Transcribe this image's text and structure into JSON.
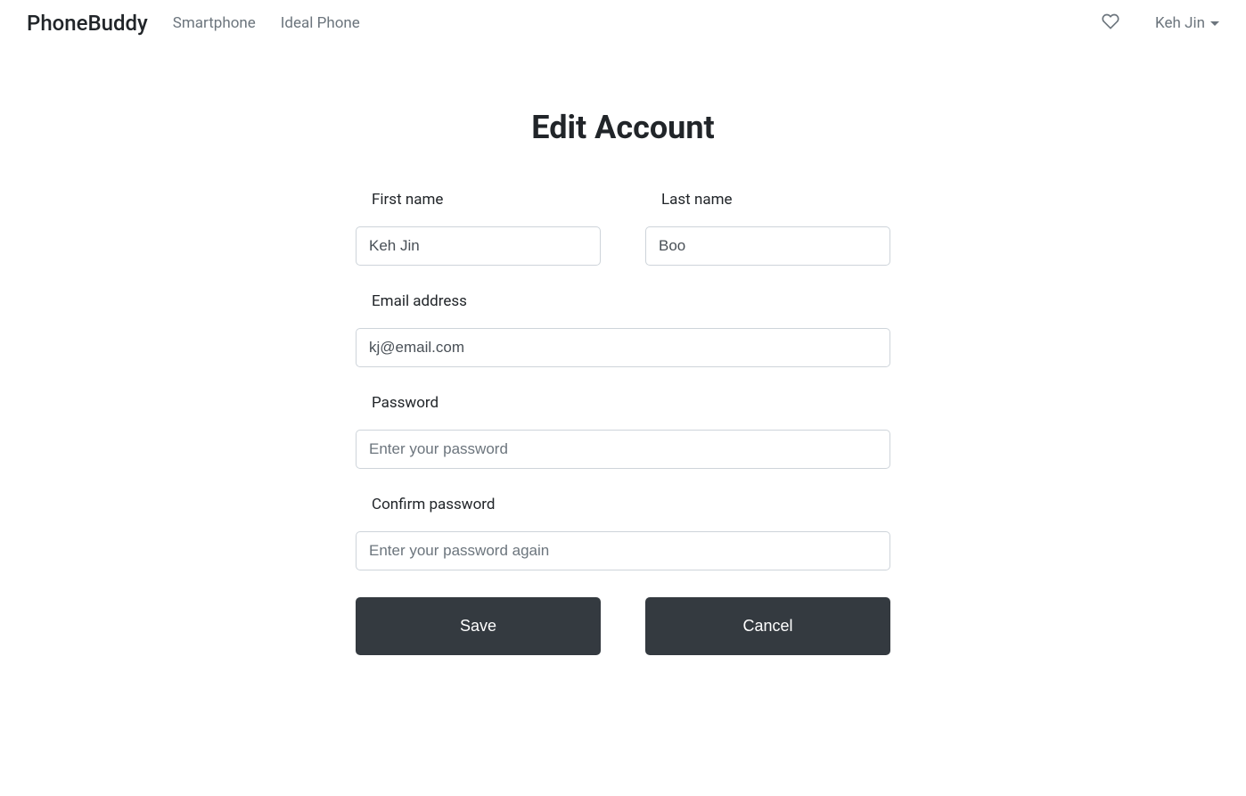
{
  "navbar": {
    "brand": "PhoneBuddy",
    "links": {
      "smartphone": "Smartphone",
      "ideal_phone": "Ideal Phone"
    },
    "user_name": "Keh Jin"
  },
  "page": {
    "title": "Edit Account"
  },
  "form": {
    "first_name": {
      "label": "First name",
      "value": "Keh Jin"
    },
    "last_name": {
      "label": "Last name",
      "value": "Boo"
    },
    "email": {
      "label": "Email address",
      "value": "kj@email.com"
    },
    "password": {
      "label": "Password",
      "placeholder": "Enter your password"
    },
    "confirm_password": {
      "label": "Confirm password",
      "placeholder": "Enter your password again"
    },
    "save_label": "Save",
    "cancel_label": "Cancel"
  }
}
